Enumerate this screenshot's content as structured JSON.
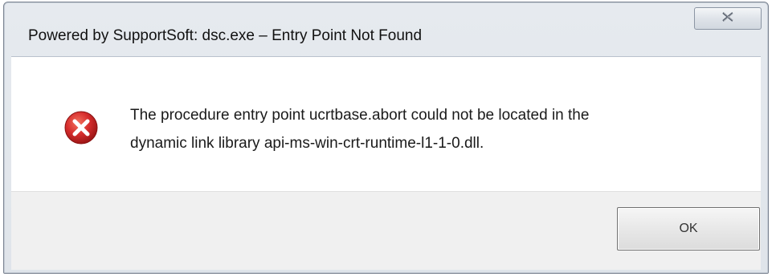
{
  "dialog": {
    "title": "Powered by SupportSoft: dsc.exe – Entry Point Not Found",
    "close_icon": "close-x-icon",
    "message_line1": "The procedure entry point ucrtbase.abort could not be located in the",
    "message_line2": "dynamic link library api-ms-win-crt-runtime-l1-1-0.dll.",
    "error_icon": "error-icon",
    "ok_label": "OK"
  },
  "colors": {
    "error_red": "#d62d2d",
    "content_bg": "#ffffff",
    "footer_bg": "#f0f0f0",
    "frame_bg": "#e3e7ec"
  }
}
